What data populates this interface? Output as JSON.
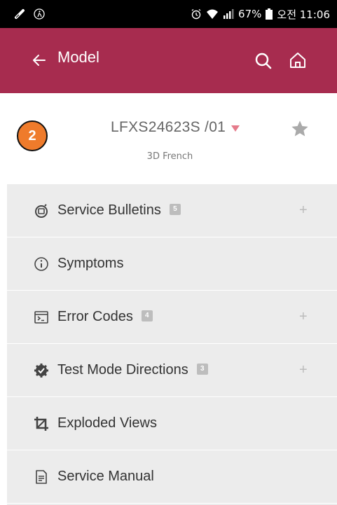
{
  "status_bar": {
    "battery": "67%",
    "time": "오전 11:06"
  },
  "app_bar": {
    "title": "Model"
  },
  "step_badge": "2",
  "model": {
    "name": "LFXS24623S /01",
    "subtitle": "3D French"
  },
  "menu": [
    {
      "label": "Service Bulletins",
      "count": "5",
      "icon": "bulletins-icon",
      "expandable": true
    },
    {
      "label": "Symptoms",
      "count": null,
      "icon": "info-icon",
      "expandable": false
    },
    {
      "label": "Error Codes",
      "count": "4",
      "icon": "terminal-icon",
      "expandable": true
    },
    {
      "label": "Test Mode Directions",
      "count": "3",
      "icon": "gear-check-icon",
      "expandable": true
    },
    {
      "label": "Exploded Views",
      "count": null,
      "icon": "crop-icon",
      "expandable": false
    },
    {
      "label": "Service Manual",
      "count": null,
      "icon": "document-icon",
      "expandable": false
    }
  ],
  "colors": {
    "app_bar": "#a72c4f",
    "step_badge": "#ef7b2b",
    "menu_bg": "#ececec",
    "caret": "#e57b8b"
  }
}
